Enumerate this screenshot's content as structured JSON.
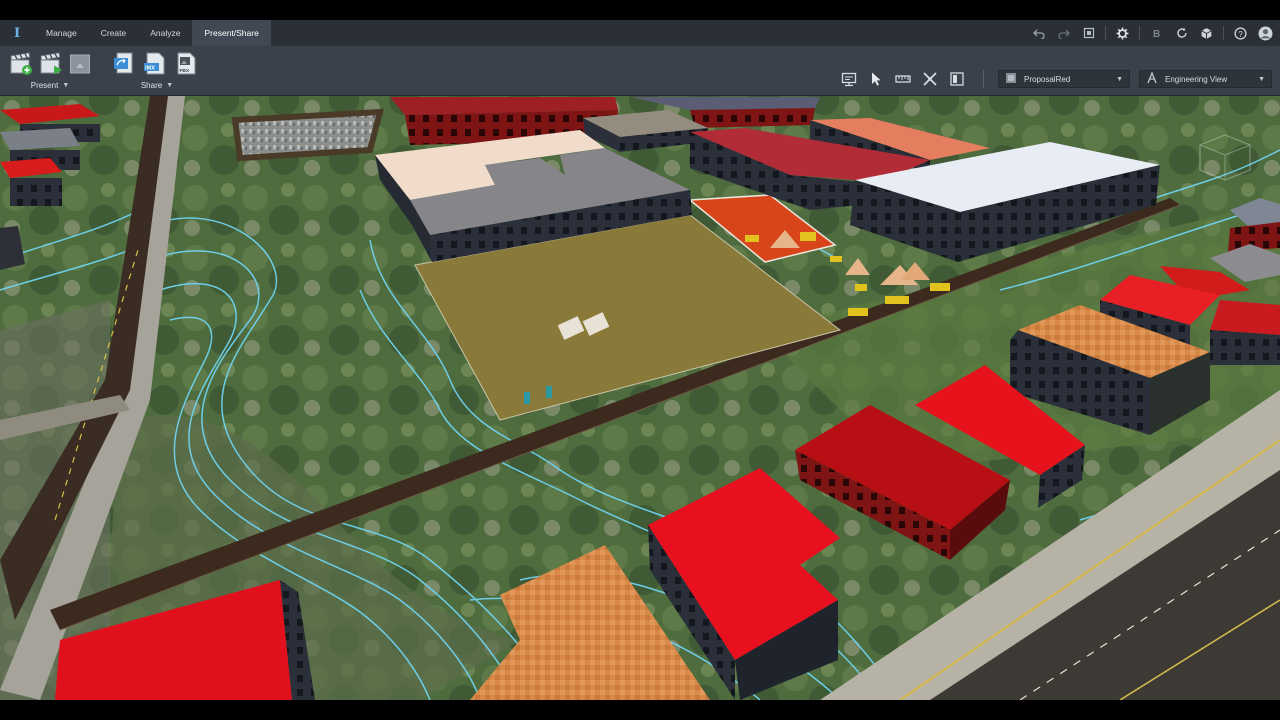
{
  "menu": {
    "logo": "I",
    "tabs": [
      {
        "label": "Manage"
      },
      {
        "label": "Create"
      },
      {
        "label": "Analyze"
      },
      {
        "label": "Present/Share",
        "active": true
      }
    ]
  },
  "titlebar_icons": [
    "undo-icon",
    "redo-icon",
    "fit-view-icon",
    "settings-icon",
    "bim-icon",
    "refresh-icon",
    "cube-icon",
    "help-icon",
    "user-avatar-icon"
  ],
  "ribbon": {
    "present_group": {
      "label": "Present",
      "buttons": [
        "storyboard-add-icon",
        "storyboard-play-icon",
        "snapshot-icon"
      ]
    },
    "share_group": {
      "label": "Share",
      "buttons": [
        "publish-icon",
        "export-imx-icon",
        "export-fbx-icon"
      ]
    }
  },
  "view_tools": [
    "screen-icon",
    "select-pointer-icon",
    "measure-icon",
    "transform-icon",
    "layout-icon"
  ],
  "proposal_dropdown": {
    "value": "ProposalRed",
    "icon": "proposal-icon"
  },
  "view_dropdown": {
    "value": "Engineering View",
    "icon": "view-style-icon"
  },
  "colors": {
    "menu_bar": "#2b3038",
    "ribbon": "#3a414b",
    "active_tab": "#3f4853",
    "accent": "#6fb4e8",
    "contour": "#6fd3f0",
    "road": "#3b2a1d",
    "site_pad": "#8a7a3a",
    "building_red": "#d81c1c",
    "building_orange": "#d88a48"
  }
}
